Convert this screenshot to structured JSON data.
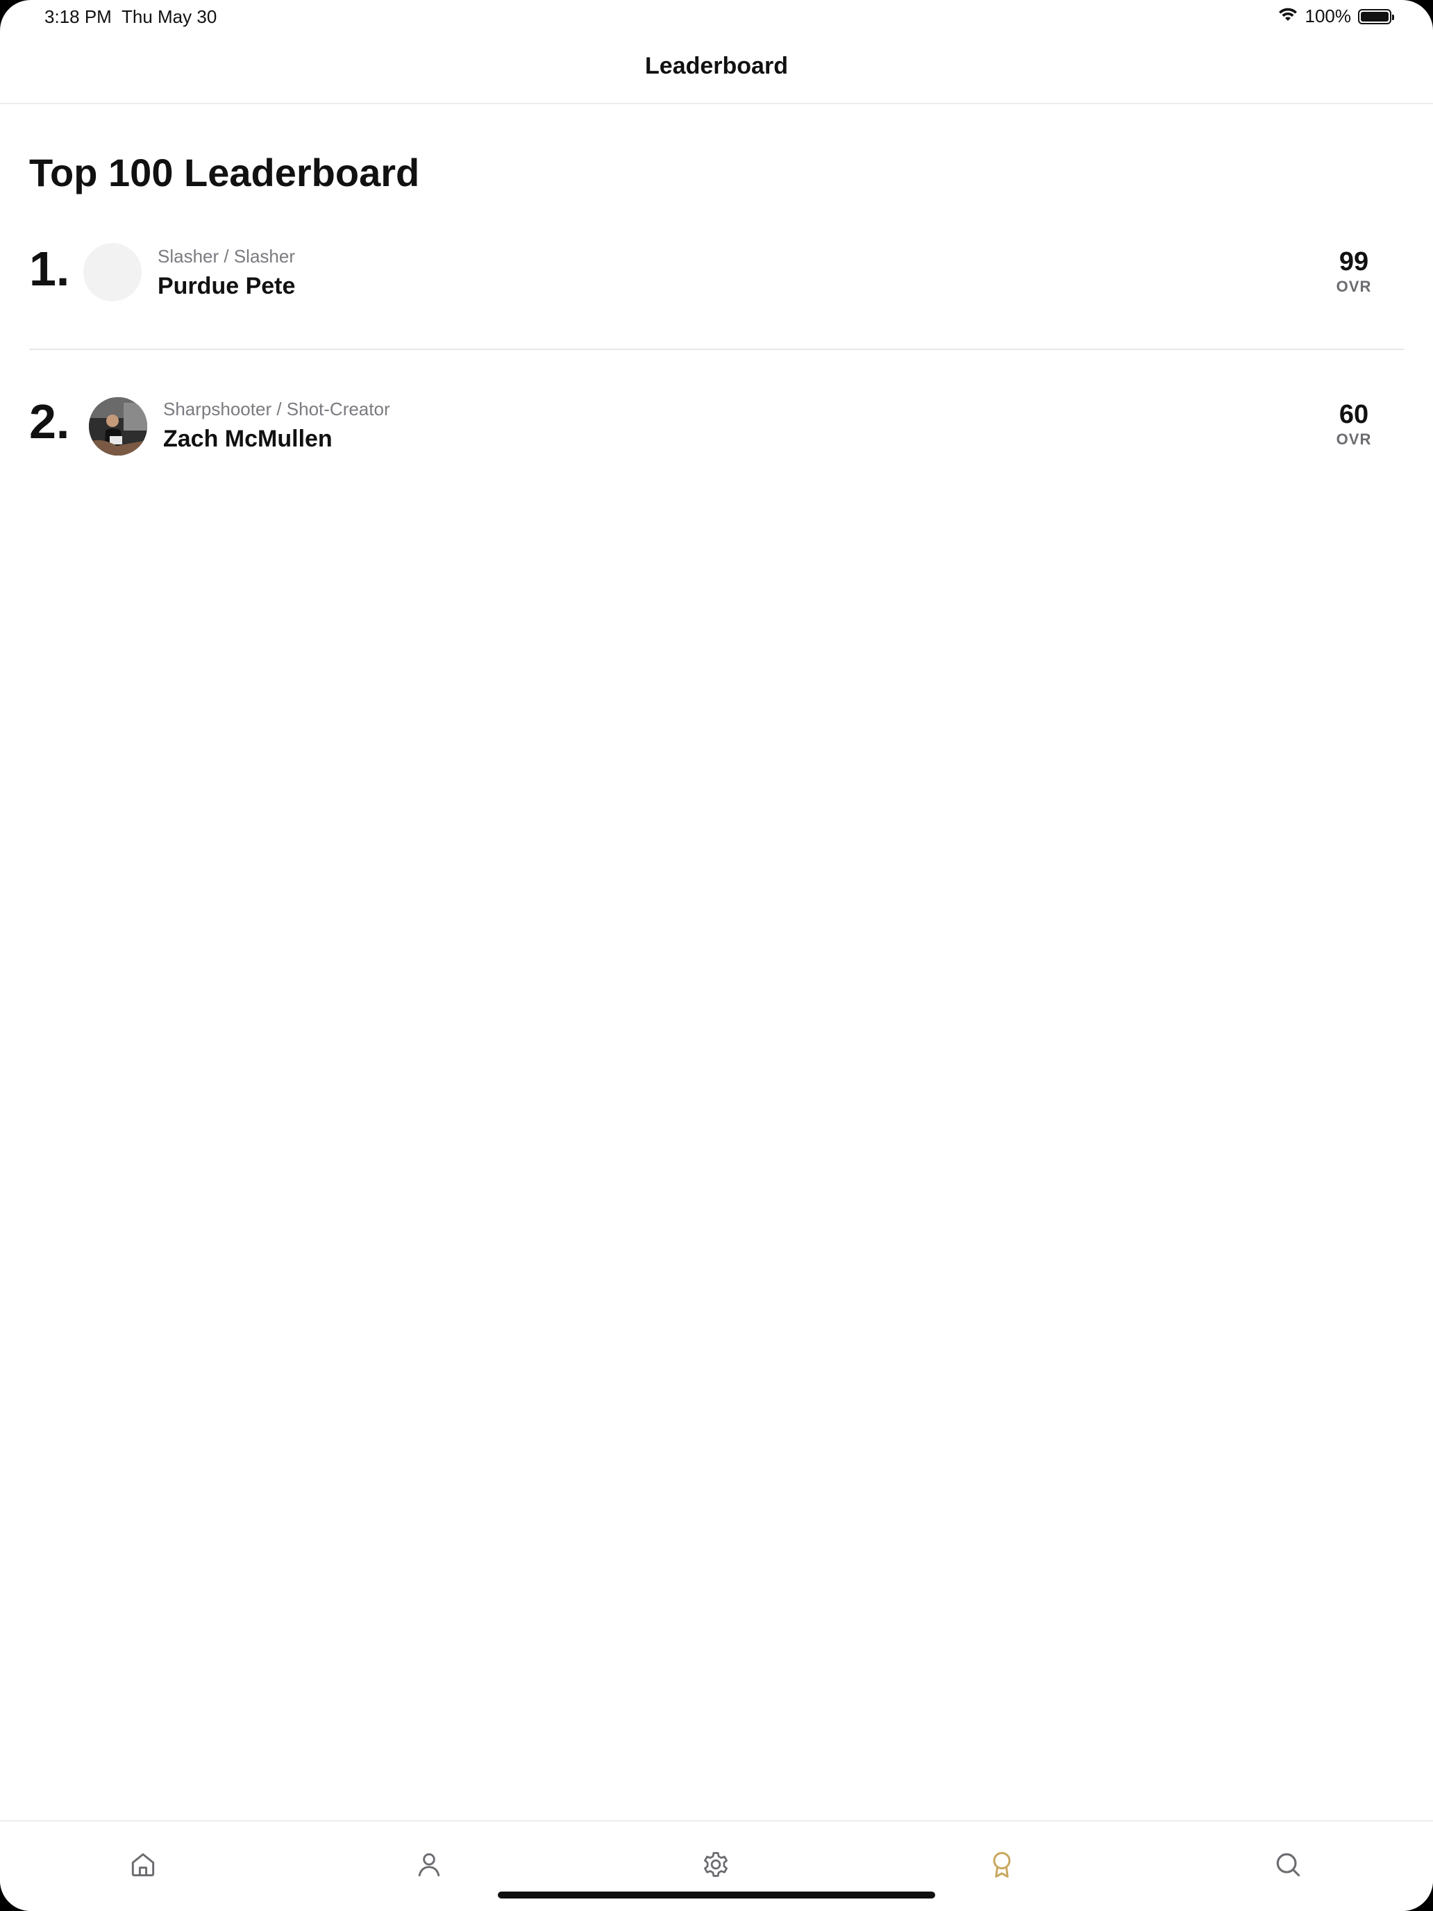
{
  "status_bar": {
    "time": "3:18 PM",
    "date": "Thu May 30",
    "battery_percent": "100%"
  },
  "nav": {
    "title": "Leaderboard"
  },
  "page": {
    "heading": "Top 100 Leaderboard"
  },
  "leaderboard": [
    {
      "rank": "1.",
      "archetype": "Slasher / Slasher",
      "name": "Purdue Pete",
      "score": "99",
      "score_label": "OVR",
      "has_photo": false
    },
    {
      "rank": "2.",
      "archetype": "Sharpshooter / Shot-Creator",
      "name": "Zach McMullen",
      "score": "60",
      "score_label": "OVR",
      "has_photo": true
    }
  ],
  "tab_bar": {
    "items": [
      {
        "icon": "home-icon",
        "active": false
      },
      {
        "icon": "profile-icon",
        "active": false
      },
      {
        "icon": "gear-icon",
        "active": false
      },
      {
        "icon": "award-ribbon-icon",
        "active": true
      },
      {
        "icon": "search-icon",
        "active": false
      }
    ],
    "active_color": "#C9A75E",
    "inactive_color": "#6B6B70"
  }
}
